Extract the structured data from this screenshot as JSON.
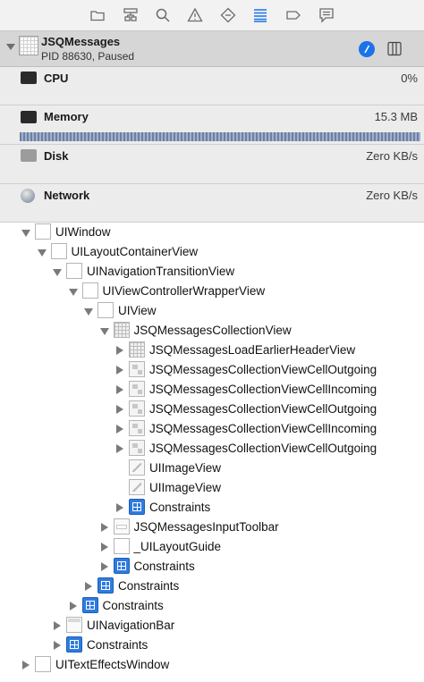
{
  "toolbar": {
    "icons": [
      "folder-icon",
      "hierarchy-icon",
      "search-icon",
      "warning-icon",
      "breakpoint-icon",
      "debug-list-icon",
      "tag-icon",
      "message-icon"
    ],
    "active_icon": "debug-list-icon",
    "accent_color": "#1a73e8"
  },
  "process": {
    "name": "JSQMessages",
    "status": "PID 88630, Paused"
  },
  "gauges": [
    {
      "label": "CPU",
      "value": "0%"
    },
    {
      "label": "Memory",
      "value": "15.3 MB"
    },
    {
      "label": "Disk",
      "value": "Zero KB/s"
    },
    {
      "label": "Network",
      "value": "Zero KB/s"
    }
  ],
  "tree": [
    {
      "label": "UIWindow",
      "depth": 0,
      "state": "open",
      "icon": "view"
    },
    {
      "label": "UILayoutContainerView",
      "depth": 1,
      "state": "open",
      "icon": "view"
    },
    {
      "label": "UINavigationTransitionView",
      "depth": 2,
      "state": "open",
      "icon": "view"
    },
    {
      "label": "UIViewControllerWrapperView",
      "depth": 3,
      "state": "open",
      "icon": "view"
    },
    {
      "label": "UIView",
      "depth": 4,
      "state": "open",
      "icon": "view"
    },
    {
      "label": "JSQMessagesCollectionView",
      "depth": 5,
      "state": "open",
      "icon": "grid"
    },
    {
      "label": "JSQMessagesLoadEarlierHeaderView",
      "depth": 6,
      "state": "closed",
      "icon": "grid"
    },
    {
      "label": "JSQMessagesCollectionViewCellOutgoing",
      "depth": 6,
      "state": "closed",
      "icon": "cell"
    },
    {
      "label": "JSQMessagesCollectionViewCellIncoming",
      "depth": 6,
      "state": "closed",
      "icon": "cell"
    },
    {
      "label": "JSQMessagesCollectionViewCellOutgoing",
      "depth": 6,
      "state": "closed",
      "icon": "cell"
    },
    {
      "label": "JSQMessagesCollectionViewCellIncoming",
      "depth": 6,
      "state": "closed",
      "icon": "cell"
    },
    {
      "label": "JSQMessagesCollectionViewCellOutgoing",
      "depth": 6,
      "state": "closed",
      "icon": "cell"
    },
    {
      "label": "UIImageView",
      "depth": 6,
      "state": "none",
      "icon": "img"
    },
    {
      "label": "UIImageView",
      "depth": 6,
      "state": "none",
      "icon": "img"
    },
    {
      "label": "Constraints",
      "depth": 6,
      "state": "closed",
      "icon": "constraint"
    },
    {
      "label": "JSQMessagesInputToolbar",
      "depth": 5,
      "state": "closed",
      "icon": "toolbar"
    },
    {
      "label": "_UILayoutGuide",
      "depth": 5,
      "state": "closed",
      "icon": "view"
    },
    {
      "label": "Constraints",
      "depth": 5,
      "state": "closed",
      "icon": "constraint"
    },
    {
      "label": "Constraints",
      "depth": 4,
      "state": "closed",
      "icon": "constraint"
    },
    {
      "label": "Constraints",
      "depth": 3,
      "state": "closed",
      "icon": "constraint"
    },
    {
      "label": "UINavigationBar",
      "depth": 2,
      "state": "closed",
      "icon": "navbar"
    },
    {
      "label": "Constraints",
      "depth": 2,
      "state": "closed",
      "icon": "constraint"
    },
    {
      "label": "UITextEffectsWindow",
      "depth": 0,
      "state": "closed",
      "icon": "view"
    }
  ]
}
